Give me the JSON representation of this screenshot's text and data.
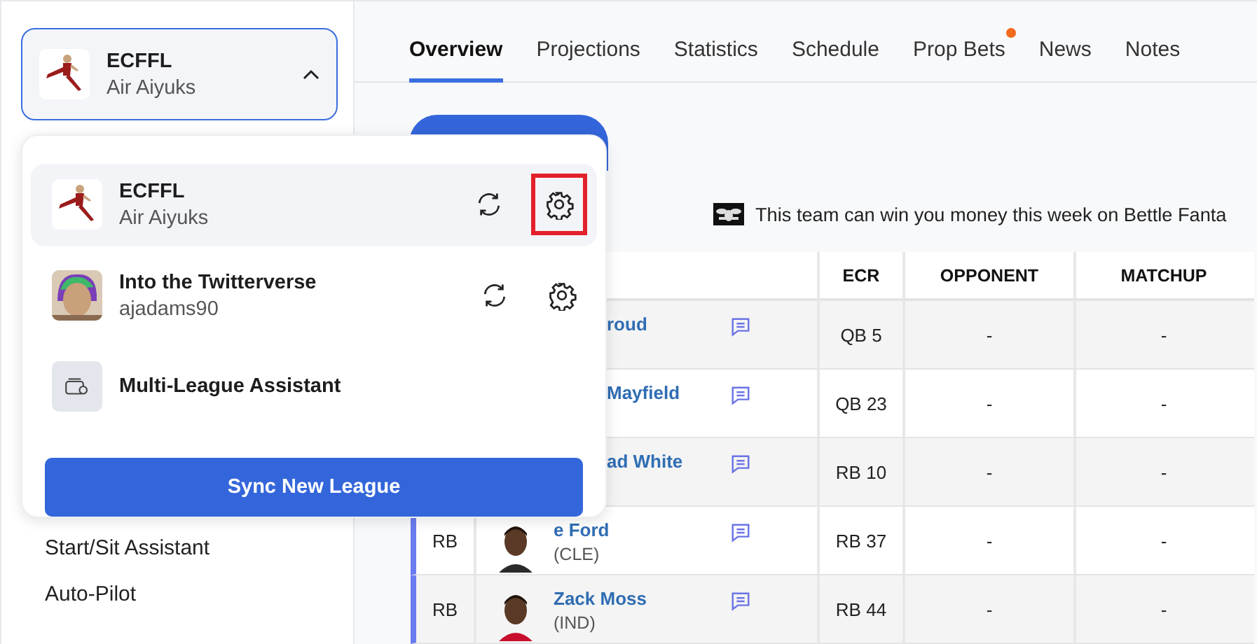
{
  "league_selector": {
    "league": "ECFFL",
    "team": "Air Aiyuks",
    "expanded": true
  },
  "tabs": [
    {
      "label": "Overview",
      "selected": true,
      "badge": false
    },
    {
      "label": "Projections",
      "selected": false,
      "badge": false
    },
    {
      "label": "Statistics",
      "selected": false,
      "badge": false
    },
    {
      "label": "Schedule",
      "selected": false,
      "badge": false
    },
    {
      "label": "Prop Bets",
      "selected": false,
      "badge": true
    },
    {
      "label": "News",
      "selected": false,
      "badge": false
    },
    {
      "label": "Notes",
      "selected": false,
      "badge": false
    }
  ],
  "league_menu": {
    "items": [
      {
        "kind": "league",
        "league": "ECFFL",
        "team": "Air Aiyuks",
        "selected": true,
        "highlighted": true
      },
      {
        "kind": "league",
        "league": "Into the Twitterverse",
        "team": "ajadams90",
        "selected": false,
        "highlighted": false
      },
      {
        "kind": "tool",
        "label": "Multi-League Assistant"
      }
    ],
    "sync_button": "Sync New League"
  },
  "sidebar": {
    "items": [
      "Start/Sit Assistant",
      "Auto-Pilot"
    ]
  },
  "promo": {
    "text": "This team can win you money this week on Bettle Fanta"
  },
  "table": {
    "columns": [
      "ECR",
      "OPPONENT",
      "MATCHUP"
    ],
    "rows": [
      {
        "name": "roud",
        "ecr": "QB 5",
        "opponent": "-",
        "matchup": "-"
      },
      {
        "name": "Mayfield",
        "ecr": "QB 23",
        "opponent": "-",
        "matchup": "-"
      },
      {
        "name": "ad White",
        "ecr": "RB 10",
        "opponent": "-",
        "matchup": "-"
      },
      {
        "position": "RB",
        "name": "e Ford",
        "team": "(CLE)",
        "ecr": "RB 37",
        "opponent": "-",
        "matchup": "-"
      },
      {
        "position": "RB",
        "name": "Zack Moss",
        "team": "(IND)",
        "ecr": "RB 44",
        "opponent": "-",
        "matchup": "-"
      }
    ]
  }
}
